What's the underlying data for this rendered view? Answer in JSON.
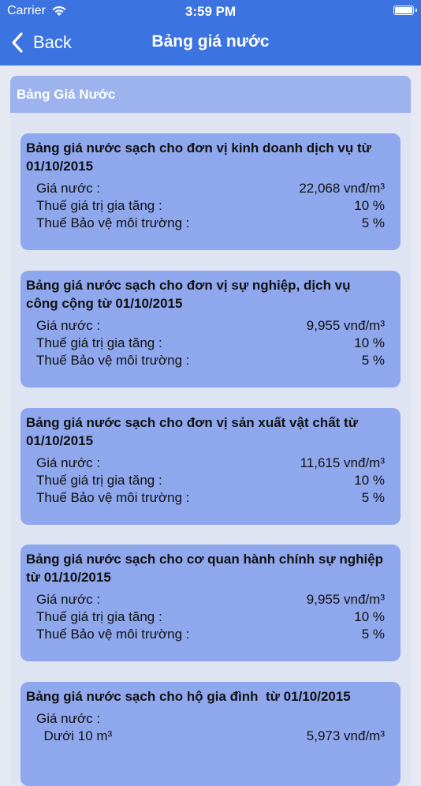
{
  "status_bar": {
    "carrier": "Carrier",
    "time": "3:59 PM"
  },
  "nav": {
    "back_label": "Back",
    "title": "Bảng giá nước"
  },
  "panel": {
    "title": "Bảng Giá Nước"
  },
  "cards": [
    {
      "title": "Bảng giá nước sạch cho đơn vị kinh doanh dịch vụ từ 01/10/2015",
      "rows": [
        {
          "label": "Giá nước :",
          "value": "22,068 vnđ/m³"
        },
        {
          "label": "Thuế giá trị gia tăng :",
          "value": "10 %"
        },
        {
          "label": "Thuế Bảo vệ môi trường :",
          "value": "5 %"
        }
      ]
    },
    {
      "title": "Bảng giá nước sạch cho đơn vị sự nghiệp, dịch vụ công cộng từ 01/10/2015",
      "rows": [
        {
          "label": "Giá nước :",
          "value": "9,955 vnđ/m³"
        },
        {
          "label": "Thuế giá trị gia tăng :",
          "value": "10 %"
        },
        {
          "label": "Thuế Bảo vệ môi trường :",
          "value": "5 %"
        }
      ]
    },
    {
      "title": "Bảng giá nước sạch cho đơn vị sản xuất vật chất từ 01/10/2015",
      "rows": [
        {
          "label": "Giá nước :",
          "value": "11,615 vnđ/m³"
        },
        {
          "label": "Thuế giá trị gia tăng :",
          "value": "10 %"
        },
        {
          "label": "Thuế Bảo vệ môi trường :",
          "value": "5 %"
        }
      ]
    },
    {
      "title": "Bảng giá nước sạch cho cơ quan hành chính sự nghiệp từ 01/10/2015",
      "rows": [
        {
          "label": "Giá nước :",
          "value": "9,955 vnđ/m³"
        },
        {
          "label": "Thuế giá trị gia tăng :",
          "value": "10 %"
        },
        {
          "label": "Thuế Bảo vệ môi trường :",
          "value": "5 %"
        }
      ]
    },
    {
      "title": "Bảng giá nước sạch cho hộ gia đình  từ 01/10/2015",
      "rows": [
        {
          "label": "Giá nước :",
          "value": ""
        },
        {
          "label": "  Dưới 10 m³",
          "value": "5,973 vnđ/m³"
        }
      ]
    }
  ]
}
